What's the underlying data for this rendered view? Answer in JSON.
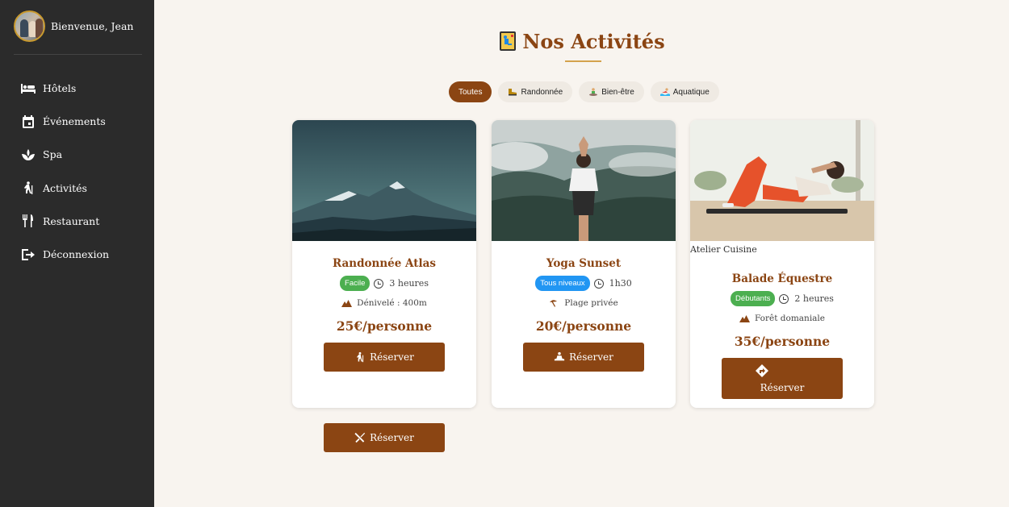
{
  "user": {
    "welcome": "Bienvenue, Jean"
  },
  "sidebar": {
    "items": [
      {
        "label": "Hôtels",
        "icon": "bed-icon"
      },
      {
        "label": "Événements",
        "icon": "calendar-icon"
      },
      {
        "label": "Spa",
        "icon": "spa-icon"
      },
      {
        "label": "Activités",
        "icon": "hiking-icon"
      },
      {
        "label": "Restaurant",
        "icon": "utensils-icon"
      },
      {
        "label": "Déconnexion",
        "icon": "logout-icon"
      }
    ]
  },
  "page": {
    "title": "Nos Activités",
    "title_icon": "climbing-icon"
  },
  "filters": [
    {
      "label": "Toutes",
      "active": true
    },
    {
      "label": "Randonnée",
      "icon": "hiking-boot-icon"
    },
    {
      "label": "Bien-être",
      "icon": "lotus-position-icon"
    },
    {
      "label": "Aquatique",
      "icon": "swimmer-icon"
    }
  ],
  "cards": [
    {
      "name": "Randonnée Atlas",
      "badge": "Facile",
      "badge_color": "#4caf50",
      "duration": "3 heures",
      "detail": "Dénivelé : 400m",
      "detail_icon": "mountain-icon",
      "price": "25€/personne",
      "button": "Réserver",
      "button_icon": "hiking-icon",
      "image": "mountains-image"
    },
    {
      "name": "Yoga Sunset",
      "badge": "Tous niveaux",
      "badge_color": "#2196f3",
      "duration": "1h30",
      "detail": "Plage privée",
      "detail_icon": "umbrella-beach-icon",
      "price": "20€/personne",
      "button": "Réserver",
      "button_icon": "meditation-icon",
      "image": "yoga-image"
    },
    {
      "caption": "Atelier Cuisine",
      "name": "Balade Équestre",
      "badge": "Débutants",
      "badge_color": "#4caf50",
      "duration": "2 heures",
      "detail": "Forêt domaniale",
      "detail_icon": "mountain-icon",
      "price": "35€/personne",
      "button": "Réserver",
      "button_icon": "directions-icon",
      "image": "workout-image"
    }
  ],
  "extra_button": {
    "label": "Réserver",
    "icon": "utensils-icon"
  },
  "colors": {
    "brand": "#8b4513",
    "sidebar_bg": "#2b2b2b",
    "page_bg": "#f8f4ef",
    "accent_gold": "#d4a24c"
  }
}
